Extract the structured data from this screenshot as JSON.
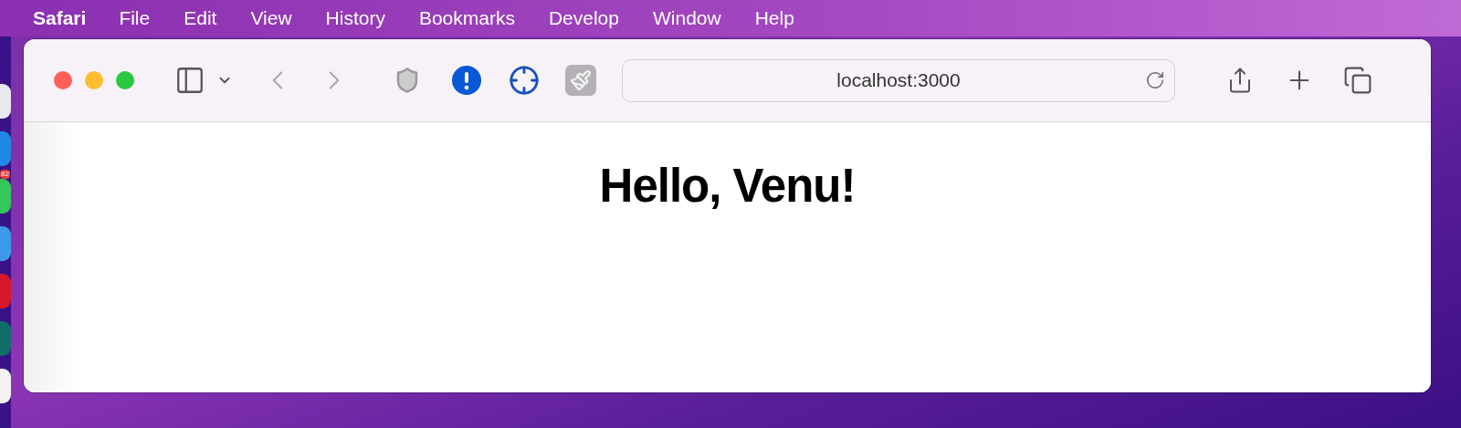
{
  "menu_bar": {
    "app_name": "Safari",
    "items": [
      "File",
      "Edit",
      "View",
      "History",
      "Bookmarks",
      "Develop",
      "Window",
      "Help"
    ]
  },
  "dock": {
    "badge": "82"
  },
  "browser": {
    "address": "localhost:3000"
  },
  "page": {
    "heading": "Hello, Venu!"
  }
}
